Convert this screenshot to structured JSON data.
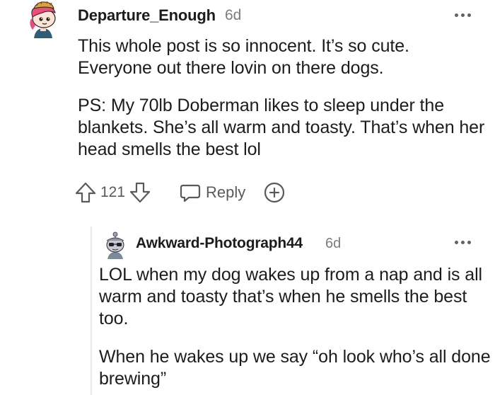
{
  "comments": [
    {
      "username": "Departure_Enough",
      "age": "6d",
      "paragraphs": [
        "This whole post is so innocent. It’s so cute. Everyone out there lovin on there dogs.",
        "PS: My 70lb Doberman likes to sleep under the blankets. She’s all warm and toasty. That’s when her head smells the best lol"
      ],
      "score": "121",
      "reply_label": "Reply",
      "icons": {
        "avatar": "snoo-avatar",
        "upvote": "upvote-arrow-icon",
        "downvote": "downvote-arrow-icon",
        "reply": "speech-bubble-icon",
        "award": "plus-award-icon",
        "more": "more-options-icon"
      }
    },
    {
      "username": "Awkward-Photograph44",
      "age": "6d",
      "paragraphs": [
        "LOL when my dog wakes up from a nap and is all warm and toasty that’s when he smells the best too.",
        "When he wakes up we say “oh look who’s all done brewing”"
      ],
      "icons": {
        "avatar": "snoo-avatar",
        "more": "more-options-icon"
      }
    }
  ],
  "colors": {
    "text": "#1c1c1c",
    "meta": "#7c7c7c",
    "icon": "#5a5a5a",
    "thread_line": "#e8e8e8"
  }
}
